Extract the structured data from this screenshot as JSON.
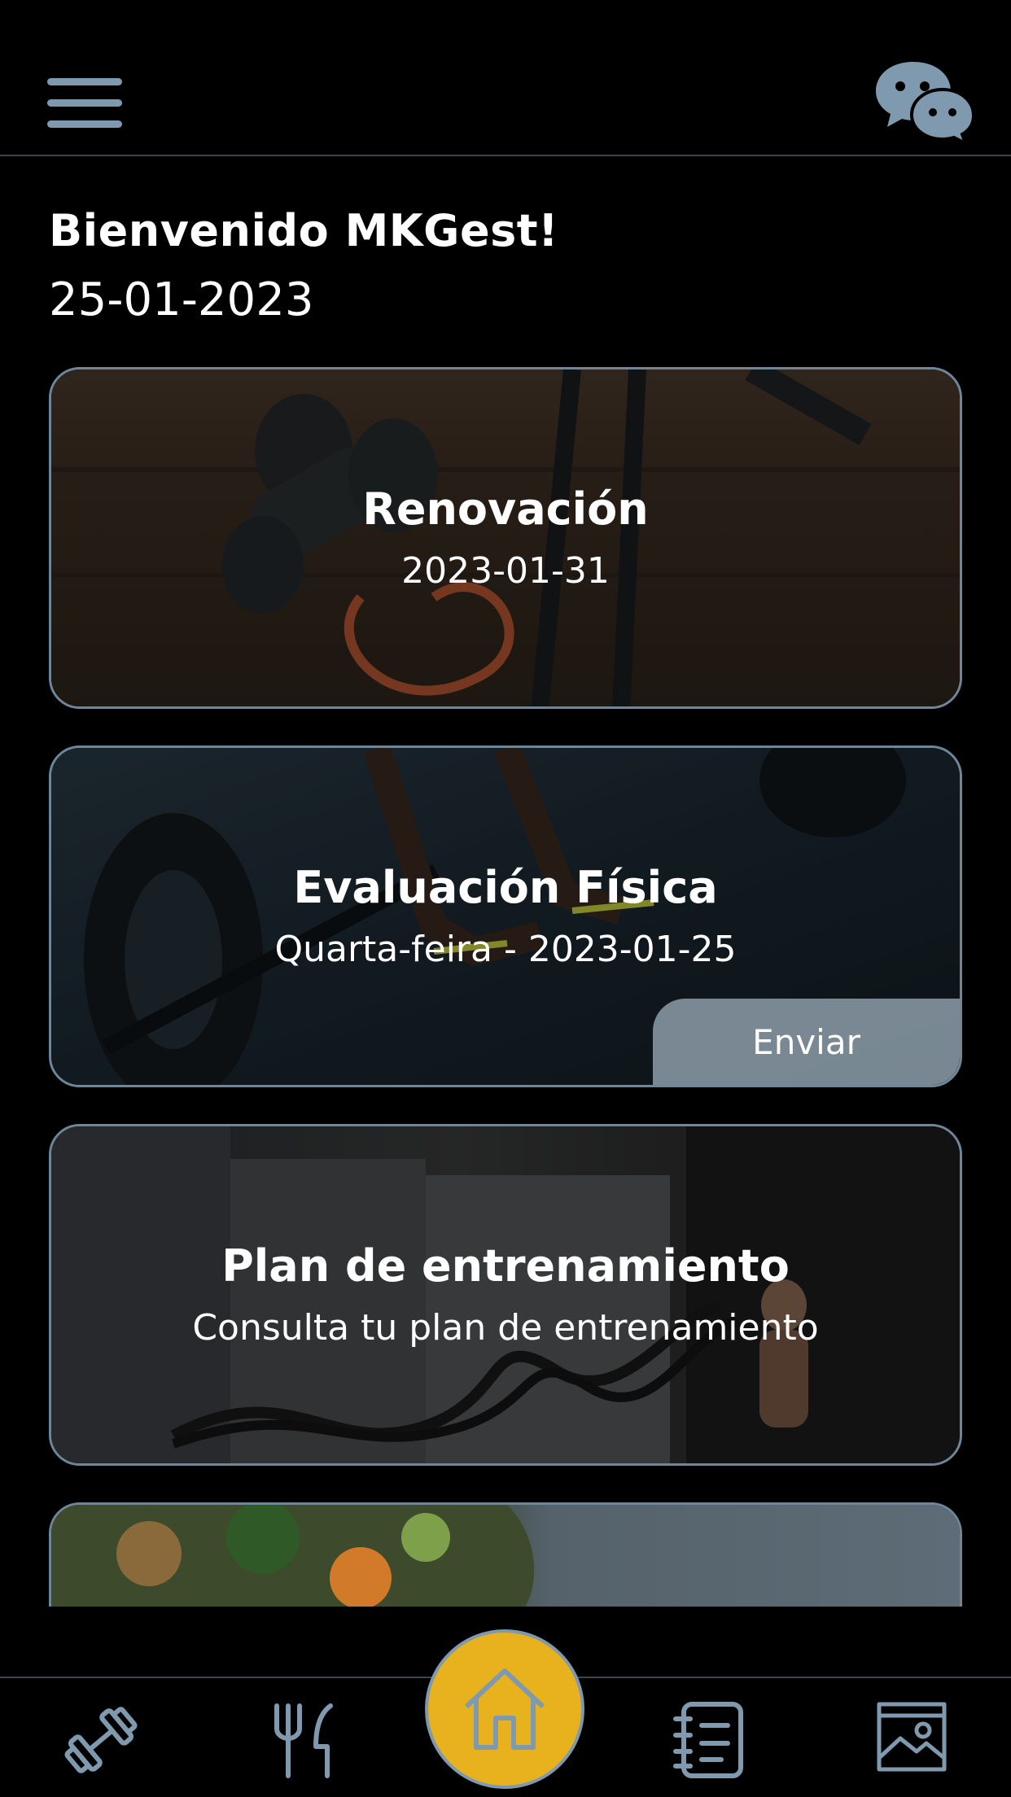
{
  "header": {
    "menu_icon": "hamburger-menu-icon",
    "chat_icon": "chat-bubbles-icon"
  },
  "welcome": {
    "greeting": "Bienvenido MKGest!",
    "date": "25-01-2023"
  },
  "cards": [
    {
      "title": "Renovación",
      "subtitle": "2023-01-31"
    },
    {
      "title": "Evaluación Física",
      "subtitle": "Quarta-feira - 2023-01-25",
      "action_label": "Enviar"
    },
    {
      "title": "Plan de entrenamiento",
      "subtitle": "Consulta tu plan de entrenamiento"
    }
  ],
  "bottom_nav": {
    "items": [
      "dumbbell-icon",
      "fork-knife-icon",
      "home-icon",
      "notebook-icon",
      "gallery-icon"
    ]
  },
  "colors": {
    "accent": "#e8b21e",
    "icon": "#7f99ae",
    "background": "#000000"
  }
}
